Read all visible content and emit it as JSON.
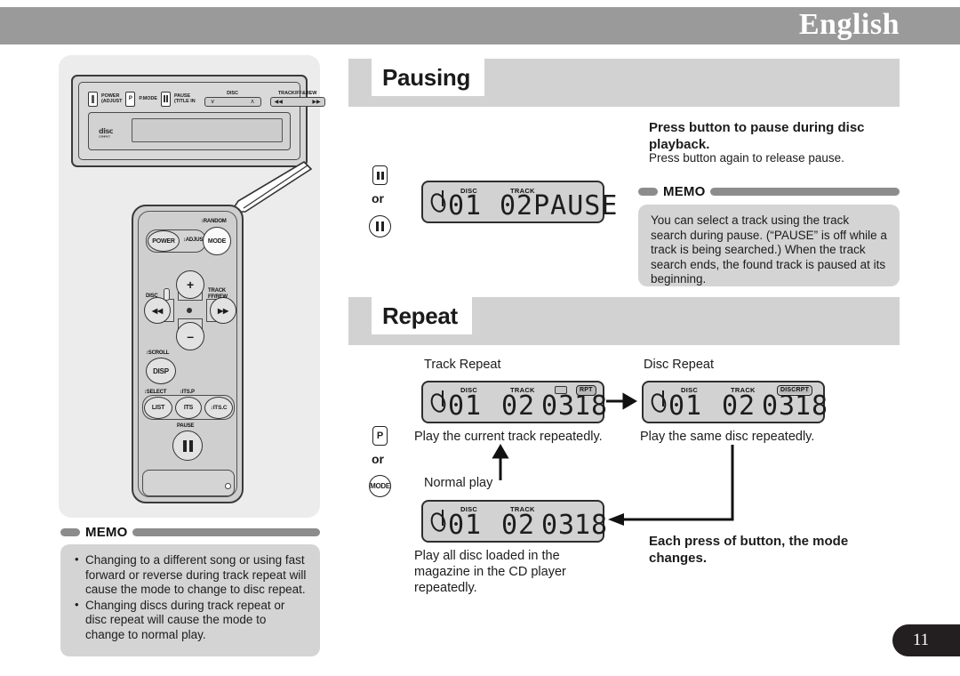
{
  "header": {
    "language_title": "English"
  },
  "page": {
    "number": "11"
  },
  "illustration": {
    "head_unit": {
      "buttons": [
        {
          "icon": "power-button-icon",
          "label_line1": "POWER",
          "label_line2": "(ADJUST"
        },
        {
          "icon": "p-mode-button-icon",
          "label_line1": "P.MODE",
          "label_line2": ""
        },
        {
          "icon": "pause-button-icon",
          "label_line1": "PAUSE",
          "label_line2": "(TITLE IN"
        }
      ],
      "disc_group_label": "DISC",
      "track_group_label": "TRACK/FF&REW",
      "track_prev": "◀◀",
      "track_next": "▶▶",
      "cd_logo": "disc"
    },
    "remote": {
      "power_label": "POWER",
      "adjust_label": "↕ADJUST",
      "random_label": "↕RANDOM",
      "mode_label": "MODE",
      "disc_label": "DISC",
      "track_label_line1": "TRACK",
      "track_label_line2": "FF/REW",
      "scroll_label": "↕SCROLL",
      "disp_label": "DISP",
      "select_label": "↕SELECT",
      "itsp_label": "↕ITS.P",
      "list_label": "LIST",
      "its_label": "ITS",
      "itsc_label": "↕ITS.C",
      "pause_label": "PAUSE",
      "plus_label": "+",
      "minus_label": "–",
      "prev_label": "◀◀",
      "next_label": "▶▶"
    }
  },
  "left_memo": {
    "title": "MEMO",
    "items": [
      "Changing to a different song or using fast forward or reverse during track repeat will cause the mode to change to disc repeat.",
      "Changing discs during track repeat or disc repeat will cause the mode to change to normal play."
    ]
  },
  "pausing_section": {
    "heading": "Pausing",
    "instruction_bold": "Press button to pause during disc playback.",
    "instruction_sub": "Press button again to release pause.",
    "or_label": "or",
    "key_rect_icon": "pause-key-icon",
    "key_circle_icon": "pause-circle-key-icon",
    "lcd": {
      "disc_label": "DISC",
      "track_label": "TRACK",
      "disc_value": "01",
      "track_value": "02PAUSE",
      "note_icon": "music-note-icon"
    },
    "memo": {
      "title": "MEMO",
      "text": "You can select a track using the track search during pause. (“PAUSE” is off while a track is being searched.) When the track search ends, the found track is paused at its beginning."
    }
  },
  "repeat_section": {
    "heading": "Repeat",
    "or_label": "or",
    "key_rect_label": "P",
    "key_circle_label": "MODE",
    "footer_bold": "Each press of button, the mode changes.",
    "modes": [
      {
        "title": "Track Repeat",
        "caption": "Play the current track repeatedly.",
        "lcd": {
          "disc_label": "DISC",
          "track_label": "TRACK",
          "disc_value": "01",
          "track_value": "02",
          "time_value": "03",
          "time_value2": "18",
          "badge": "RPT",
          "note_icon": "music-note-icon"
        }
      },
      {
        "title": "Disc Repeat",
        "caption": "Play the same disc repeatedly.",
        "lcd": {
          "disc_label": "DISC",
          "track_label": "TRACK",
          "disc_value": "01",
          "track_value": "02",
          "time_value": "03",
          "time_value2": "18",
          "badge": "DISCRPT",
          "note_icon": "music-note-icon"
        }
      },
      {
        "title": "Normal play",
        "caption": "Play all disc loaded in the magazine in the CD player repeatedly.",
        "lcd": {
          "disc_label": "DISC",
          "track_label": "TRACK",
          "disc_value": "01",
          "track_value": "02",
          "time_value": "03",
          "time_value2": "18",
          "badge": "",
          "note_icon": "music-note-icon"
        }
      }
    ]
  },
  "colors": {
    "header_band": "#9a9a9a",
    "section_band": "#d2d2d2",
    "memo_bg": "#d4d4d4",
    "panel_bg": "#ececec",
    "lcd_bg": "#d2d2d2",
    "page_tab": "#231f20"
  }
}
